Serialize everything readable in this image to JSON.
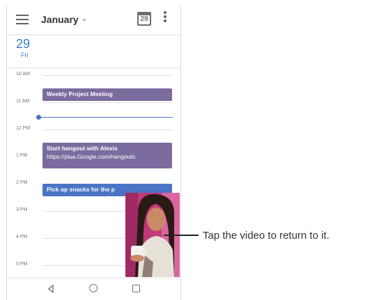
{
  "header": {
    "month": "January",
    "calendar_icon_day": "29"
  },
  "day": {
    "number": "29",
    "weekday": "Fri"
  },
  "hours": [
    "10 AM",
    "11 AM",
    "12 PM",
    "1 PM",
    "2 PM",
    "3 PM",
    "4 PM",
    "5 PM"
  ],
  "events": [
    {
      "title": "Weekly Project Meeting",
      "subtitle": "",
      "color": "#7b6b9e"
    },
    {
      "title": "Start hangout with Alexis",
      "subtitle": "https://plua.Google.com/hangouts",
      "color": "#7b6b9e"
    },
    {
      "title": "Pick up snacks for the p",
      "subtitle": "",
      "color": "#4a74c5"
    }
  ],
  "callout": {
    "text": "Tap the video to return to it."
  },
  "icons": {
    "menu": "hamburger-menu-icon",
    "today": "calendar-today-icon",
    "more": "more-vertical-icon",
    "back": "back-triangle-icon",
    "home": "home-circle-icon",
    "recents": "recents-square-icon"
  },
  "colors": {
    "accent": "#3b78c9",
    "event_purple": "#7b6b9e",
    "event_blue": "#4a74c5"
  }
}
